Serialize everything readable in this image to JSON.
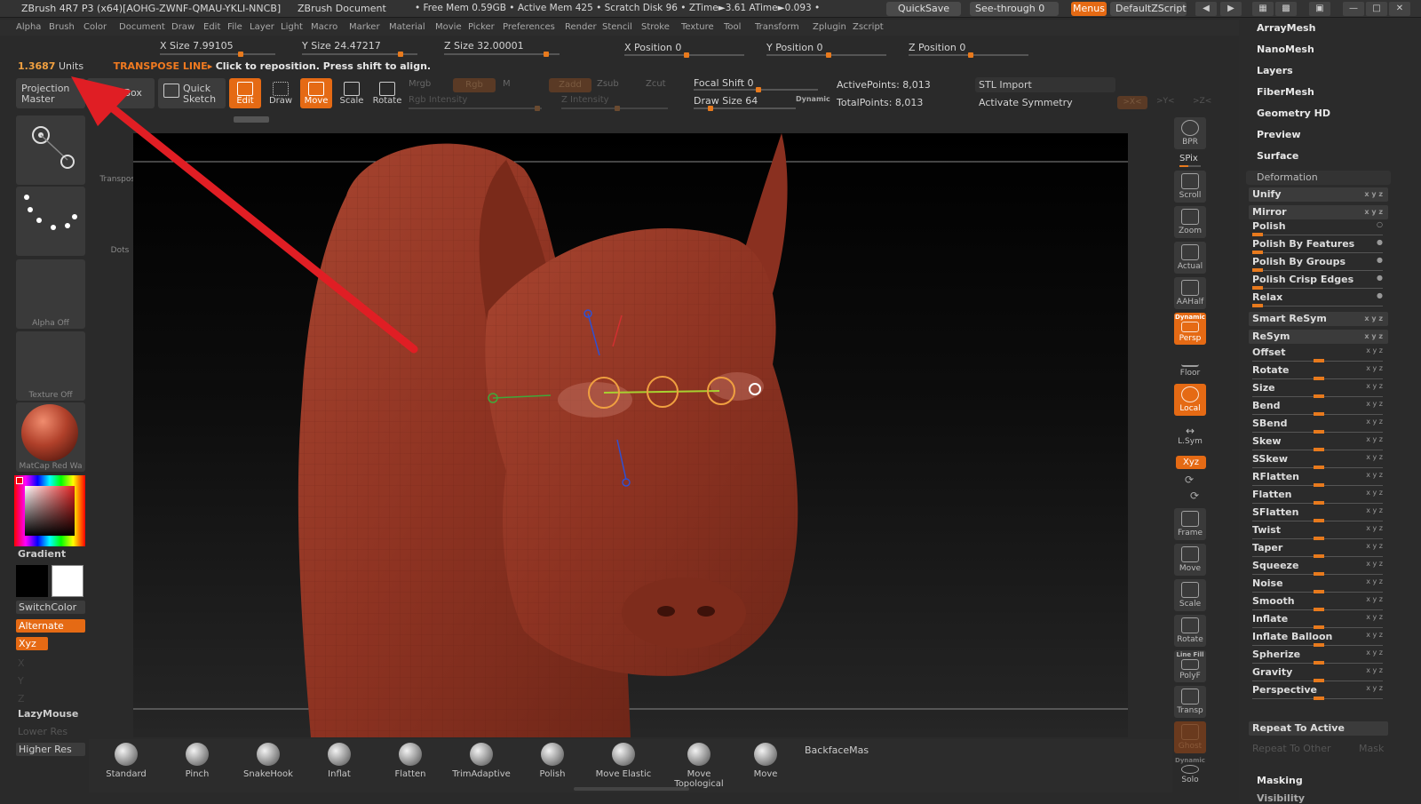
{
  "titlebar": {
    "app": "ZBrush 4R7 P3 (x64)[AOHG-ZWNF-QMAU-YKLI-NNCB]",
    "document": "ZBrush Document",
    "stats": "• Free Mem 0.59GB • Active Mem 425 • Scratch Disk 96 •  ZTime►3.61  ATime►0.093 •",
    "quicksave": "QuickSave",
    "see_through": "See-through  0",
    "menus": "Menus",
    "zscript": "DefaultZScript"
  },
  "menubar": [
    "Alpha",
    "Brush",
    "Color",
    "Document",
    "Draw",
    "Edit",
    "File",
    "Layer",
    "Light",
    "Macro",
    "Marker",
    "Material",
    "Movie",
    "Picker",
    "Preferences",
    "Render",
    "Stencil",
    "Stroke",
    "Texture",
    "Tool",
    "Transform",
    "Zplugin",
    "Zscript"
  ],
  "sizes": {
    "x_size": "X Size 7.99105",
    "y_size": "Y Size 24.47217",
    "z_size": "Z Size 32.00001",
    "x_pos": "X Position 0",
    "y_pos": "Y Position 0",
    "z_pos": "Z Position 0"
  },
  "status": {
    "units_value": "1.3687",
    "units": "Units",
    "mode": "TRANSPOSE LINE▸",
    "hint": "Click to reposition. Press shift to align."
  },
  "toolbar": {
    "projection_master": "Projection Master",
    "lightbox": "LightBox",
    "quick_sketch": "Quick Sketch",
    "edit": "Edit",
    "draw": "Draw",
    "move": "Move",
    "scale": "Scale",
    "rotate": "Rotate",
    "mrgb": "Mrgb",
    "rgb": "Rgb",
    "m": "M",
    "zadd": "Zadd",
    "zsub": "Zsub",
    "zcut": "Zcut",
    "rgb_intensity": "Rgb Intensity",
    "z_intensity": "Z Intensity",
    "focal_shift": "Focal Shift 0",
    "draw_size": "Draw Size 64",
    "dynamic": "Dynamic",
    "active_points": "ActivePoints: 8,013",
    "total_points": "TotalPoints: 8,013",
    "stl_import": "STL Import",
    "activate_symmetry": "Activate Symmetry",
    "sym_x": ">X<",
    "sym_y": ">Y<",
    "sym_z": ">Z<"
  },
  "left": {
    "transpose": "Transpose",
    "dots": "Dots",
    "alpha_off": "Alpha  Off",
    "texture_off": "Texture  Off",
    "matcap": "MatCap  Red  Wa",
    "gradient": "Gradient",
    "switchcolor": "SwitchColor",
    "alternate": "Alternate",
    "xyz": "Xyz",
    "x": "X",
    "y": "Y",
    "z": "Z",
    "lazymouse": "LazyMouse",
    "lower_res": "Lower Res",
    "higher_res": "Higher Res"
  },
  "right_tools": [
    "BPR",
    "SPix",
    "Scroll",
    "Zoom",
    "Actual",
    "AAHalf",
    "Persp",
    "Floor",
    "Local",
    "L.Sym",
    "Xyz",
    "Frame",
    "Move",
    "Scale",
    "Rotate",
    "PolyF",
    "Transp",
    "Ghost",
    "Solo"
  ],
  "right_tools_extra": {
    "dynamic": "Dynamic",
    "line_fill": "Line Fill"
  },
  "rightpanel": {
    "top_items": [
      "ArrayMesh",
      "NanoMesh",
      "Layers",
      "FiberMesh",
      "Geometry HD",
      "Preview",
      "Surface"
    ],
    "section": "Deformation",
    "buttons": [
      "Unify",
      "Mirror"
    ],
    "polish_items": [
      "Polish",
      "Polish By Features",
      "Polish By Groups",
      "Polish Crisp Edges",
      "Relax"
    ],
    "buttons2": [
      "Smart ReSym",
      "ReSym"
    ],
    "sliders": [
      "Offset",
      "Rotate",
      "Size",
      "Bend",
      "SBend",
      "Skew",
      "SSkew",
      "RFlatten",
      "Flatten",
      "SFlatten",
      "Twist",
      "Taper",
      "Squeeze",
      "Noise",
      "Smooth",
      "Inflate",
      "Inflate Balloon",
      "Spherize",
      "Gravity",
      "Perspective"
    ],
    "repeat_active": "Repeat To Active",
    "repeat_other": "Repeat To Other",
    "mask": "Mask",
    "masking": "Masking",
    "visibility": "Visibility"
  },
  "brushes": [
    "Standard",
    "Pinch",
    "SnakeHook",
    "Inflat",
    "Flatten",
    "TrimAdaptive",
    "Polish",
    "Move  Elastic",
    "Move  Topological",
    "Move"
  ],
  "backface": "BackfaceMas",
  "colors": {
    "accent": "#e56a14",
    "model": "#a0402e",
    "annotation_arrow": "#e01e24",
    "background": "#2a2a2a"
  }
}
